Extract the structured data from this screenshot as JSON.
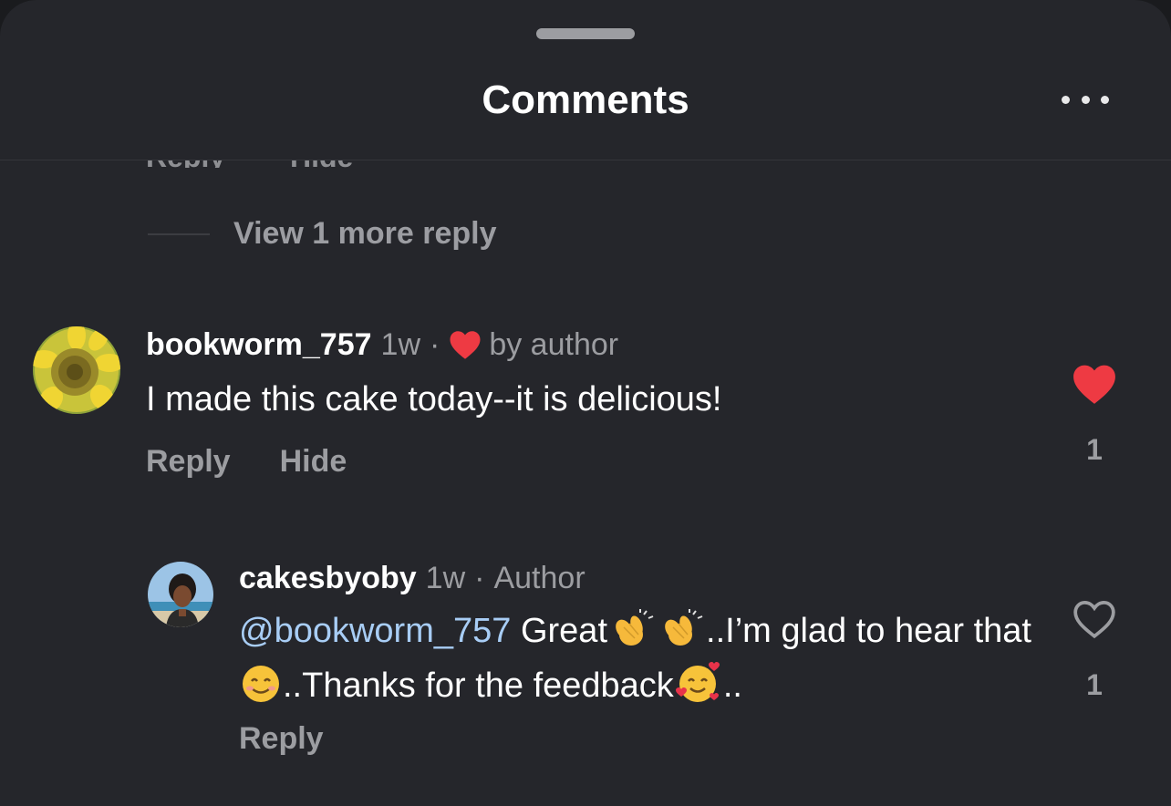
{
  "header": {
    "title": "Comments"
  },
  "thread_prev": {
    "partial_reply_label": "Reply",
    "partial_hide_label": "Hide",
    "view_more_replies": "View 1 more reply"
  },
  "comments": [
    {
      "username": "bookworm_757",
      "time": "1w",
      "separator": "·",
      "liked_by_author": "by author",
      "text": "I made this cake today--it is delicious!",
      "reply_label": "Reply",
      "hide_label": "Hide",
      "like_count": "1",
      "liked": true
    },
    {
      "username": "cakesbyoby",
      "time": "1w",
      "separator": "·",
      "role": "Author",
      "mention": "@bookworm_757",
      "text_part1": " Great",
      "text_part2": "..I’m glad to hear that",
      "text_part3": "..Thanks for the feedback",
      "text_part4": "..",
      "reply_label": "Reply",
      "like_count": "1",
      "liked": false
    }
  ],
  "colors": {
    "background": "#25262b",
    "heart": "#ee3a43",
    "mention": "#a8cdf5",
    "muted": "#9c9da1"
  },
  "icons": [
    "more-icon",
    "heart-filled-icon",
    "heart-outline-icon",
    "clapping-hands-emoji",
    "smiling-face-emoji",
    "smiling-face-with-hearts-emoji"
  ]
}
